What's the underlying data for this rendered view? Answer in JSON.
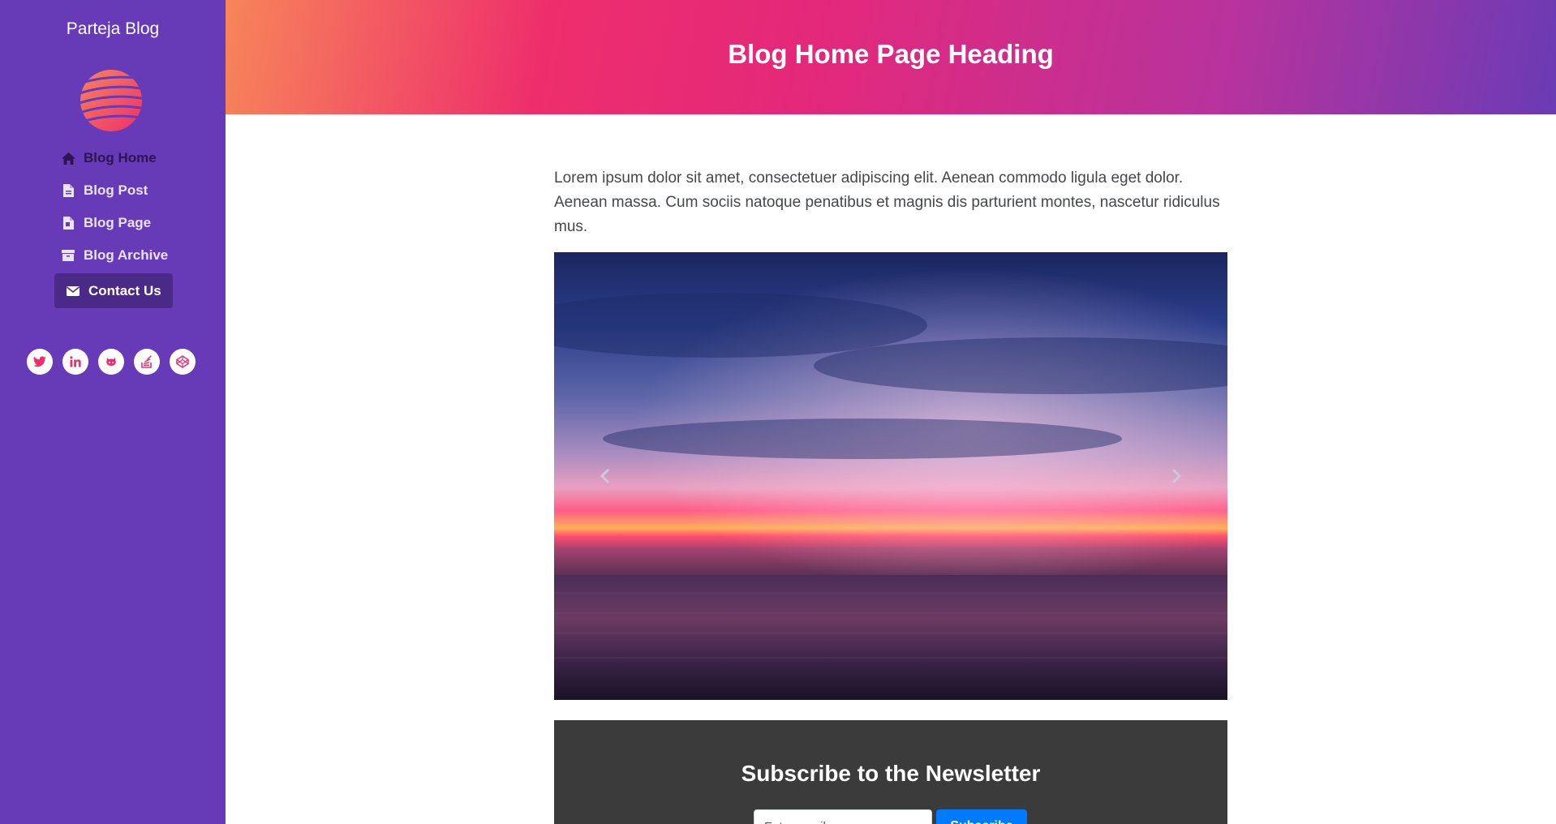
{
  "sidebar": {
    "brand": "Parteja Blog",
    "nav": [
      {
        "label": "Blog Home",
        "icon": "home-icon"
      },
      {
        "label": "Blog Post",
        "icon": "file-icon"
      },
      {
        "label": "Blog Page",
        "icon": "file-alt-icon"
      },
      {
        "label": "Blog Archive",
        "icon": "archive-icon"
      },
      {
        "label": "Contact Us",
        "icon": "envelope-icon"
      }
    ],
    "social": [
      "twitter-icon",
      "linkedin-icon",
      "github-icon",
      "stack-overflow-icon",
      "codepen-icon"
    ]
  },
  "header": {
    "title": "Blog Home Page Heading"
  },
  "main": {
    "intro": "Lorem ipsum dolor sit amet, consectetuer adipiscing elit. Aenean commodo ligula eget dolor. Aenean massa. Cum sociis natoque penatibus et magnis dis parturient montes, nascetur ridiculus mus."
  },
  "newsletter": {
    "title": "Subscribe to the Newsletter",
    "email_placeholder": "Enter email",
    "button_label": "Subscribe"
  },
  "colors": {
    "sidebar_bg": "#673ab7",
    "active_nav_bg": "#4a2a86",
    "accent_pink": "#ee2e6c",
    "newsletter_bg": "#3b3b3b",
    "button_blue": "#007bff"
  }
}
